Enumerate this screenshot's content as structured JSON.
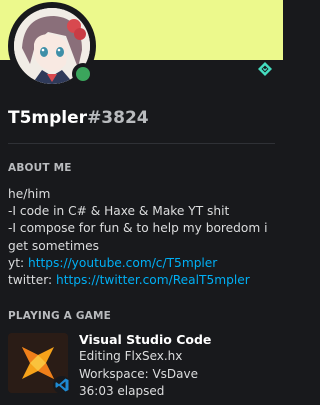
{
  "profile": {
    "username": "T5mpler",
    "discriminator": "#3824",
    "banner_color": "#ecf98c",
    "status_color": "#3ba55c",
    "badge_icon": "hypesquad-balance-icon"
  },
  "about": {
    "title": "ABOUT ME",
    "lines": [
      "he/him",
      "-I code in C# & Haxe & Make YT shit",
      "-I compose for fun & to help my boredom i",
      "get sometimes"
    ],
    "youtube_label": "yt:",
    "youtube_url": "https://youtube.com/c/T5mpler",
    "twitter_label": "twitter:",
    "twitter_url": "https://twitter.com/RealT5mpler"
  },
  "activity": {
    "title": "PLAYING A GAME",
    "app_name": "Visual Studio Code",
    "details": "Editing FlxSex.hx",
    "state": "Workspace: VsDave",
    "elapsed": "36:03 elapsed",
    "app_icon": "visual-studio-code-icon"
  }
}
